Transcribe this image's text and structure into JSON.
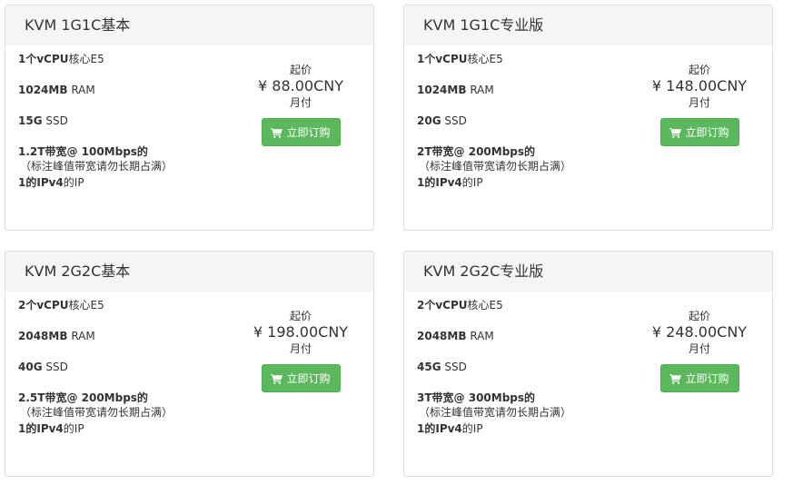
{
  "plans": [
    {
      "title": "KVM 1G1C基本",
      "features": [
        {
          "bold": "1个vCPU",
          "rest": "核心E5",
          "note": ""
        },
        {
          "bold": "1024MB",
          "rest": " RAM",
          "note": ""
        },
        {
          "bold": "15G",
          "rest": " SSD",
          "note": ""
        },
        {
          "bold": "1.2T带宽@ 100Mbps的",
          "rest": "",
          "note": "（标注峰值带宽请勿长期占满）"
        },
        {
          "bold": "1的IPv4",
          "rest": "的IP",
          "note": ""
        }
      ],
      "price_prefix": "起价",
      "price": "¥ 88.00CNY",
      "cycle": "月付",
      "button": "立即订购"
    },
    {
      "title": "KVM 1G1C专业版",
      "features": [
        {
          "bold": "1个vCPU",
          "rest": "核心E5",
          "note": ""
        },
        {
          "bold": "1024MB",
          "rest": " RAM",
          "note": ""
        },
        {
          "bold": "20G",
          "rest": " SSD",
          "note": ""
        },
        {
          "bold": "2T带宽@ 200Mbps的",
          "rest": "",
          "note": "（标注峰值带宽请勿长期占满）"
        },
        {
          "bold": "1的IPv4",
          "rest": "的IP",
          "note": ""
        }
      ],
      "price_prefix": "起价",
      "price": "¥ 148.00CNY",
      "cycle": "月付",
      "button": "立即订购"
    },
    {
      "title": "KVM 2G2C基本",
      "features": [
        {
          "bold": "2个vCPU",
          "rest": "核心E5",
          "note": ""
        },
        {
          "bold": "2048MB",
          "rest": " RAM",
          "note": ""
        },
        {
          "bold": "40G",
          "rest": " SSD",
          "note": ""
        },
        {
          "bold": "2.5T带宽@ 200Mbps的",
          "rest": "",
          "note": "（标注峰值带宽请勿长期占满）"
        },
        {
          "bold": "1的IPv4",
          "rest": "的IP",
          "note": ""
        }
      ],
      "price_prefix": "起价",
      "price": "¥ 198.00CNY",
      "cycle": "月付",
      "button": "立即订购"
    },
    {
      "title": "KVM 2G2C专业版",
      "features": [
        {
          "bold": "2个vCPU",
          "rest": "核心E5",
          "note": ""
        },
        {
          "bold": "2048MB",
          "rest": " RAM",
          "note": ""
        },
        {
          "bold": "45G",
          "rest": " SSD",
          "note": ""
        },
        {
          "bold": "3T带宽@ 300Mbps的",
          "rest": "",
          "note": "（标注峰值带宽请勿长期占满）"
        },
        {
          "bold": "1的IPv4",
          "rest": "的IP",
          "note": ""
        }
      ],
      "price_prefix": "起价",
      "price": "¥ 248.00CNY",
      "cycle": "月付",
      "button": "立即订购"
    }
  ],
  "colors": {
    "button_bg": "#5cb85c",
    "header_bg": "#f5f5f5",
    "border": "#dcdcdc"
  },
  "icons": {
    "button_icon": "shopping-cart-icon"
  }
}
